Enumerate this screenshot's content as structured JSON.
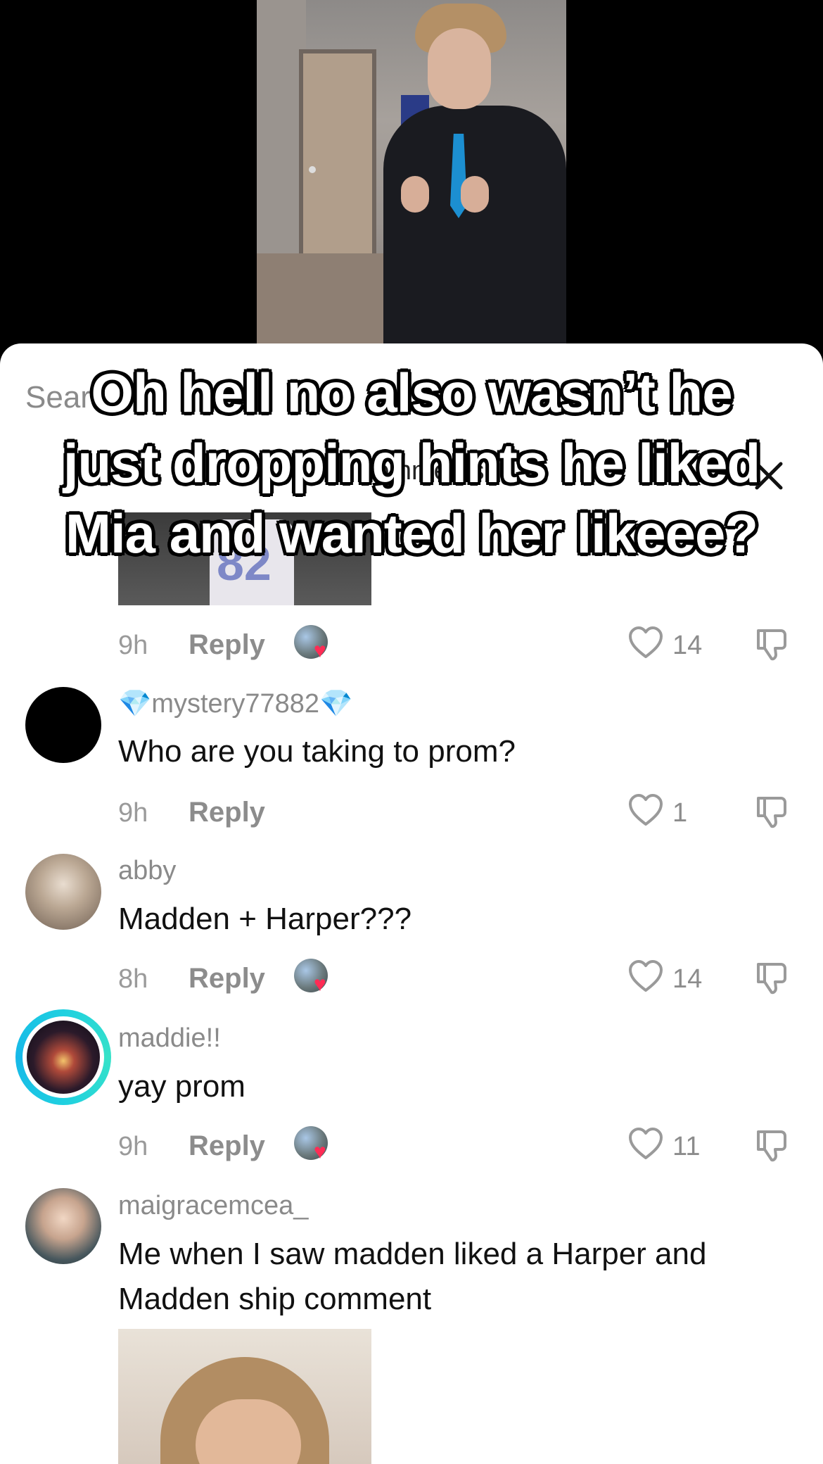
{
  "video": {
    "caption": "Oh hell no also wasn’t he just dropping hints he liked Mia and wanted her likeee?"
  },
  "sheet": {
    "search_prefix": "Sear",
    "title_partial": "7 comments"
  },
  "preview_comment": {
    "image_text": "82",
    "time": "9h",
    "reply_label": "Reply",
    "like_count": "14"
  },
  "comments": [
    {
      "username": "💎mystery77882💎",
      "text": "Who are you taking to prom?",
      "time": "9h",
      "reply_label": "Reply",
      "like_count": "1"
    },
    {
      "username": "abby",
      "text": "Madden + Harper???",
      "time": "8h",
      "reply_label": "Reply",
      "like_count": "14"
    },
    {
      "username": "maddie!!",
      "text": "yay prom",
      "time": "9h",
      "reply_label": "Reply",
      "like_count": "11"
    },
    {
      "username": "maigracemcea_",
      "text": "Me when I saw madden liked a Harper and Madden ship comment"
    }
  ],
  "colors": {
    "accent_heart": "#fe2c55",
    "story_ring": "#1fd0e0",
    "secondary_text": "#8a8a8a"
  },
  "icons": [
    "close-icon",
    "heart-outline-icon",
    "dislike-icon",
    "creator-liked-heart-icon"
  ]
}
